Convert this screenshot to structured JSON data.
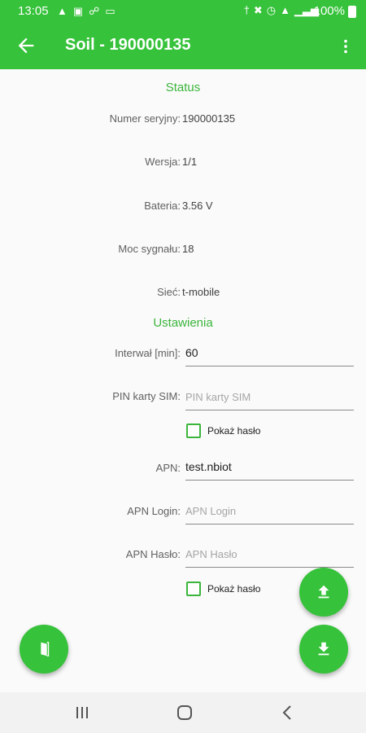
{
  "statusbar": {
    "time": "13:05",
    "battery": "100%",
    "left_icons": [
      "notification-icon",
      "image-icon",
      "link-icon",
      "screen-icon"
    ],
    "right_icons": [
      "bluetooth-icon",
      "mute-icon",
      "alarm-icon",
      "wifi-icon",
      "signal-icon"
    ]
  },
  "appbar": {
    "title": "Soil - 190000135"
  },
  "status_section": {
    "title": "Status",
    "rows": [
      {
        "label": "Numer seryjny:",
        "value": "190000135"
      },
      {
        "label": "Wersja:",
        "value": "1/1"
      },
      {
        "label": "Bateria:",
        "value": "3.56 V"
      },
      {
        "label": "Moc sygnału:",
        "value": "18"
      },
      {
        "label": "Sieć:",
        "value": "t-mobile"
      }
    ]
  },
  "settings_section": {
    "title": "Ustawienia",
    "interval": {
      "label": "Interwał [min]:",
      "value": "60"
    },
    "pin": {
      "label": "PIN karty SIM:",
      "placeholder": "PIN karty SIM"
    },
    "show_password_1": "Pokaż hasło",
    "apn": {
      "label": "APN:",
      "value": "test.nbiot"
    },
    "apn_login": {
      "label": "APN Login:",
      "placeholder": "APN Login"
    },
    "apn_password": {
      "label": "APN Hasło:",
      "placeholder": "APN Hasło"
    },
    "show_password_2": "Pokaż hasło"
  },
  "colors": {
    "accent": "#36c23a",
    "section_title": "#3bb53c"
  }
}
